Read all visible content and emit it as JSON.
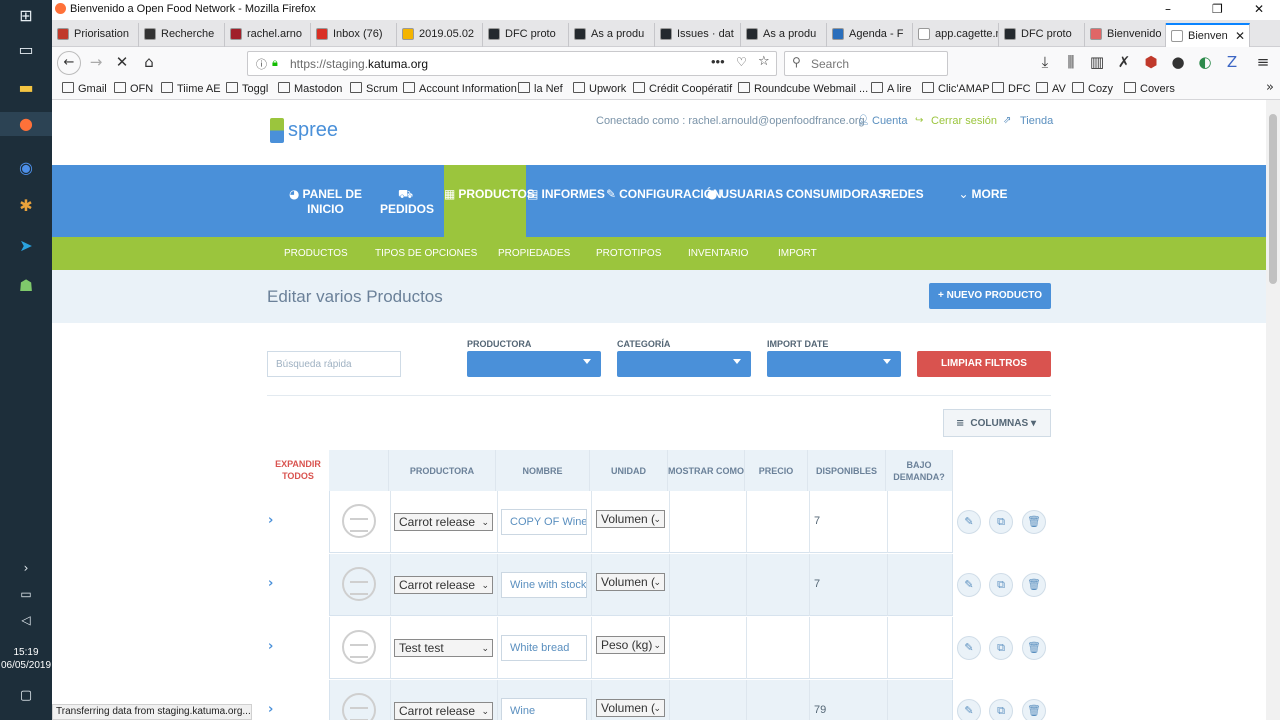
{
  "window": {
    "title": "Bienvenido a Open Food Network - Mozilla Firefox"
  },
  "taskbar": {
    "time": "15:19",
    "date": "06/05/2019"
  },
  "tabs": [
    {
      "label": "Priorisation",
      "color": "#c0392b"
    },
    {
      "label": "Recherche",
      "color": "#333333"
    },
    {
      "label": "rachel.arno",
      "color": "#a0202a"
    },
    {
      "label": "Inbox (76)",
      "color": "#d93025"
    },
    {
      "label": "2019.05.02",
      "color": "#f4b400"
    },
    {
      "label": "DFC proto",
      "color": "#24292e"
    },
    {
      "label": "As a produ",
      "color": "#24292e"
    },
    {
      "label": "Issues · dat",
      "color": "#24292e"
    },
    {
      "label": "As a produ",
      "color": "#24292e"
    },
    {
      "label": "Agenda - F",
      "color": "#2a6ebb"
    },
    {
      "label": "app.cagette.ne",
      "color": "#ffffff"
    },
    {
      "label": "DFC proto",
      "color": "#24292e"
    },
    {
      "label": "Bienvenido",
      "color": "#e06666"
    },
    {
      "label": "Bienven",
      "color": "#ffffff"
    }
  ],
  "nav": {
    "url_prefix": "https://staging.",
    "url_domain": "katuma.org",
    "search_placeholder": "Search"
  },
  "bookmarks": [
    "Gmail",
    "OFN",
    "Tiime AE",
    "Toggl",
    "Mastodon",
    "Scrum",
    "Account Information",
    "la Nef",
    "Upwork",
    "Crédit Coopératif",
    "Roundcube Webmail ...",
    "A lire",
    "Clic'AMAP",
    "DFC",
    "AV",
    "Cozy",
    "Covers"
  ],
  "header": {
    "logo": "spree",
    "connected": "Conectado como : rachel.arnould@openfoodfrance.org",
    "cuenta": "Cuenta",
    "cerrar": "Cerrar sesión",
    "tienda": "Tienda"
  },
  "mainnav": [
    {
      "label": "PANEL DE INICIO",
      "icon": "dashboard-icon"
    },
    {
      "label": "PEDIDOS",
      "icon": "cart-icon"
    },
    {
      "label": "PRODUCTOS",
      "icon": "grid-icon"
    },
    {
      "label": "INFORMES",
      "icon": "file-icon"
    },
    {
      "label": "CONFIGURACIÓN",
      "icon": "wrench-icon"
    },
    {
      "label": "USUARIAS",
      "icon": "user-icon"
    },
    {
      "label": "CONSUMIDORAS",
      "icon": ""
    },
    {
      "label": "REDES",
      "icon": ""
    },
    {
      "label": "MORE",
      "icon": "chevron-down-icon"
    }
  ],
  "subnav": [
    "PRODUCTOS",
    "TIPOS DE OPCIONES",
    "PROPIEDADES",
    "PROTOTIPOS",
    "INVENTARIO",
    "IMPORT"
  ],
  "page": {
    "title": "Editar varios Productos",
    "new_button": "+ NUEVO PRODUCTO"
  },
  "filters": {
    "search_placeholder": "Búsqueda rápida",
    "productora": "PRODUCTORA",
    "categoria": "CATEGORÍA",
    "import_date": "IMPORT DATE",
    "clear": "LIMPIAR FILTROS",
    "columns": "COLUMNAS"
  },
  "table": {
    "expand_all": "EXPANDIR TODOS",
    "headers": [
      "PRODUCTORA",
      "NOMBRE",
      "UNIDAD",
      "MOSTRAR COMO",
      "PRECIO",
      "DISPONIBLES",
      "BAJO DEMANDA?"
    ],
    "rows": [
      {
        "producer": "Carrot release",
        "name": "COPY OF Wine",
        "unit": "Volumen (",
        "display": "",
        "price": "",
        "available": "7",
        "on_demand": ""
      },
      {
        "producer": "Carrot release",
        "name": "Wine with stock",
        "unit": "Volumen (",
        "display": "",
        "price": "",
        "available": "7",
        "on_demand": ""
      },
      {
        "producer": "Test test",
        "name": "White bread",
        "unit": "Peso (kg)",
        "display": "",
        "price": "",
        "available": "",
        "on_demand": ""
      },
      {
        "producer": "Carrot release",
        "name": "Wine",
        "unit": "Volumen (",
        "display": "",
        "price": "",
        "available": "79",
        "on_demand": ""
      }
    ]
  },
  "status_text": "Transferring data from staging.katuma.org..."
}
